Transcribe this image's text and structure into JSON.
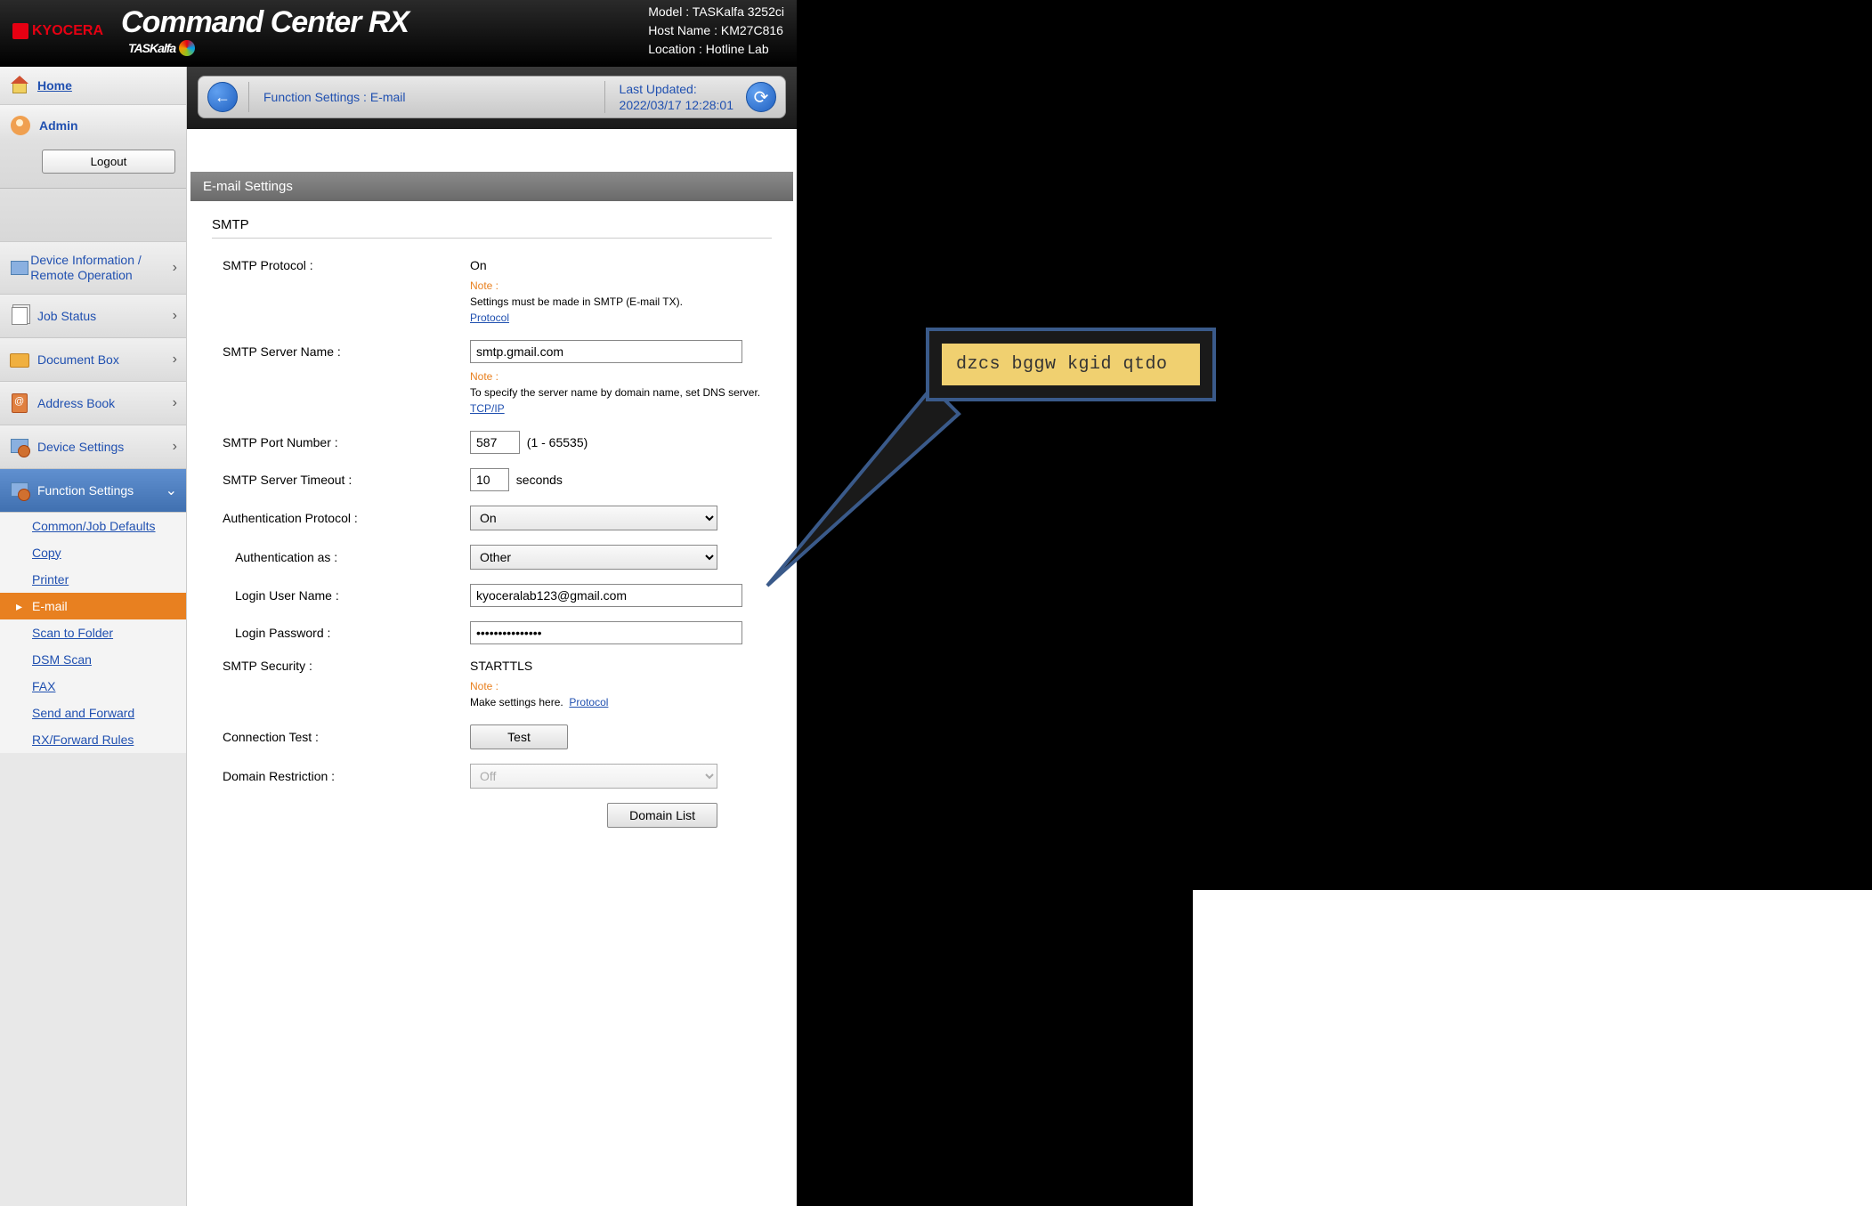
{
  "brand": {
    "company": "KYOCERA",
    "product": "Command Center RX",
    "taskalfa": "TASKalfa"
  },
  "device": {
    "model_label": "Model :",
    "model": "TASKalfa 3252ci",
    "host_label": "Host Name :",
    "host": "KM27C816",
    "loc_label": "Location :",
    "loc": "Hotline Lab"
  },
  "sidebar": {
    "home": "Home",
    "user": "Admin",
    "logout": "Logout",
    "items": [
      {
        "label": "Device Information / Remote Operation"
      },
      {
        "label": "Job Status"
      },
      {
        "label": "Document Box"
      },
      {
        "label": "Address Book"
      },
      {
        "label": "Device Settings"
      },
      {
        "label": "Function Settings"
      }
    ],
    "sub": [
      {
        "label": "Common/Job Defaults"
      },
      {
        "label": "Copy"
      },
      {
        "label": "Printer"
      },
      {
        "label": "E-mail"
      },
      {
        "label": "Scan to Folder"
      },
      {
        "label": "DSM Scan"
      },
      {
        "label": "FAX"
      },
      {
        "label": "Send and Forward"
      },
      {
        "label": "RX/Forward Rules"
      }
    ]
  },
  "breadcrumb": {
    "path": "Function Settings : E-mail",
    "updated_label": "Last Updated:",
    "updated": "2022/03/17 12:28:01"
  },
  "section": {
    "title": "E-mail Settings",
    "smtp": "SMTP"
  },
  "form": {
    "protocol_label": "SMTP Protocol :",
    "protocol_value": "On",
    "note": "Note :",
    "protocol_note": "Settings must be made in SMTP (E-mail TX).",
    "protocol_link": "Protocol",
    "server_label": "SMTP Server Name :",
    "server_value": "smtp.gmail.com",
    "server_note": "To specify the server name by domain name, set DNS server.",
    "server_link": "TCP/IP",
    "port_label": "SMTP Port Number :",
    "port_value": "587",
    "port_range": "(1 - 65535)",
    "timeout_label": "SMTP Server Timeout :",
    "timeout_value": "10",
    "timeout_unit": "seconds",
    "auth_label": "Authentication Protocol :",
    "auth_value": "On",
    "authas_label": "Authentication as :",
    "authas_value": "Other",
    "login_label": "Login User Name :",
    "login_value": "kyoceralab123@gmail.com",
    "pass_label": "Login Password :",
    "pass_value": "•••••••••••••••",
    "sec_label": "SMTP Security :",
    "sec_value": "STARTTLS",
    "sec_note": "Make settings here.",
    "sec_link": "Protocol",
    "test_label": "Connection Test :",
    "test_btn": "Test",
    "domain_label": "Domain Restriction :",
    "domain_value": "Off",
    "domain_list": "Domain List"
  },
  "callout": {
    "text": "dzcs bggw kgid qtdo"
  }
}
